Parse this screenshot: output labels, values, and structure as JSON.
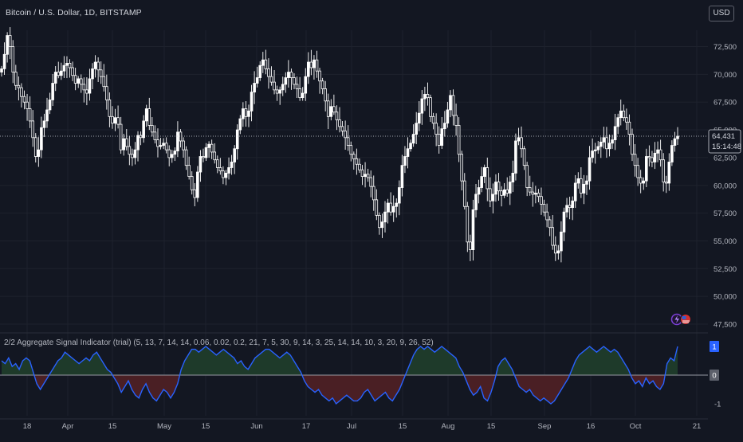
{
  "header": {
    "symbol_title": "Bitcoin / U.S. Dollar, 1D, BITSTAMP",
    "currency_button": "USD"
  },
  "price_pane": {
    "last_price_label": "64,431",
    "countdown_label": "15:14:48"
  },
  "indicator_pane": {
    "title": "2/2 Aggregate Signal Indicator (trial) (5, 13, 7, 14, 14, 0.06, 0.02, 0.2, 21, 7, 5, 30, 9, 14, 3, 25, 14, 14, 10, 3, 20, 9, 26, 52)",
    "current_value_label": "1"
  },
  "colors": {
    "background": "#131722",
    "grid": "#1e222d",
    "candle_up": "#ffffff",
    "candle_down": "#ffffff",
    "signal_line": "#2962ff",
    "positive_fill": "#1e3a2a",
    "negative_fill": "#4a1f24",
    "zero_line": "#9598a1",
    "price_label_bg": "#131722"
  },
  "chart_data": [
    {
      "type": "candlestick",
      "title": "Bitcoin / U.S. Dollar, 1D, BITSTAMP",
      "y_ticks": [
        "72,500",
        "70,000",
        "67,500",
        "65,000",
        "62,500",
        "60,000",
        "57,500",
        "55,000",
        "52,500",
        "50,000",
        "47,500"
      ],
      "x_ticks": [
        "18",
        "Apr",
        "15",
        "May",
        "15",
        "Jun",
        "17",
        "Jul",
        "15",
        "Aug",
        "15",
        "Sep",
        "16",
        "Oct",
        "21"
      ],
      "ylim": [
        47500,
        73000
      ],
      "last_price": 64431,
      "close_series": [
        70500,
        71800,
        73500,
        72500,
        70200,
        69000,
        68800,
        68000,
        67500,
        66900,
        65800,
        64300,
        62600,
        63200,
        65200,
        65800,
        66800,
        67700,
        69200,
        70200,
        69900,
        70300,
        70800,
        71000,
        70600,
        69900,
        69200,
        69600,
        69100,
        68600,
        68300,
        69600,
        70500,
        71100,
        70400,
        69800,
        68900,
        67700,
        66200,
        65600,
        66100,
        65500,
        63200,
        64200,
        63500,
        62800,
        62500,
        63200,
        64500,
        64300,
        65800,
        66900,
        65400,
        64800,
        64100,
        63500,
        63600,
        63800,
        63200,
        62500,
        62800,
        63100,
        64800,
        64000,
        63200,
        61800,
        60800,
        59600,
        58900,
        61200,
        62600,
        62500,
        63400,
        63700,
        63000,
        62300,
        61600,
        61300,
        60700,
        61100,
        61600,
        62100,
        63300,
        65000,
        66000,
        66900,
        66200,
        66700,
        68400,
        69200,
        69700,
        70800,
        71300,
        70500,
        69800,
        69300,
        68600,
        68300,
        68600,
        69100,
        69700,
        70200,
        69700,
        69100,
        68700,
        67900,
        68300,
        69800,
        71100,
        70600,
        71300,
        70300,
        69400,
        68700,
        67600,
        66200,
        67100,
        66600,
        65900,
        65300,
        64900,
        64300,
        63600,
        62800,
        62400,
        61900,
        61400,
        60800,
        61000,
        60700,
        59900,
        58700,
        57300,
        56200,
        56700,
        57600,
        58400,
        57600,
        58100,
        58400,
        59800,
        61800,
        62600,
        63300,
        63800,
        64600,
        65600,
        66500,
        67800,
        68200,
        67900,
        66200,
        65600,
        64600,
        63600,
        65100,
        65600,
        66800,
        68100,
        66300,
        65400,
        62800,
        60400,
        58100,
        54900,
        54200,
        57800,
        59200,
        59800,
        60800,
        61600,
        59700,
        58600,
        59200,
        60300,
        59500,
        59100,
        59600,
        59300,
        60300,
        61100,
        64000,
        64300,
        63300,
        61800,
        59800,
        59400,
        59200,
        59300,
        59000,
        58300,
        57600,
        56900,
        56200,
        54600,
        53900,
        54100,
        55800,
        57600,
        58200,
        58000,
        58600,
        60200,
        60600,
        59300,
        60100,
        60400,
        62500,
        63100,
        63200,
        63500,
        63900,
        64300,
        63300,
        63800,
        64100,
        65300,
        66100,
        66700,
        66100,
        65700,
        64600,
        62800,
        61800,
        60700,
        60200,
        60400,
        62600,
        62500,
        62100,
        62900,
        63200,
        62300,
        60300,
        60200,
        62100,
        63600,
        64200,
        64431
      ]
    },
    {
      "type": "area",
      "title": "2/2 Aggregate Signal Indicator (trial)",
      "y_ticks": [
        "1",
        "0",
        "-1"
      ],
      "ylim": [
        -1.15,
        1.1
      ],
      "values": [
        0.5,
        0.4,
        0.6,
        0.3,
        0.4,
        0.2,
        0.5,
        0.6,
        0.5,
        0.1,
        -0.3,
        -0.5,
        -0.3,
        -0.1,
        0.1,
        0.3,
        0.5,
        0.6,
        0.8,
        0.7,
        0.6,
        0.5,
        0.4,
        0.5,
        0.6,
        0.5,
        0.7,
        0.8,
        0.6,
        0.4,
        0.2,
        0.1,
        -0.1,
        -0.3,
        -0.6,
        -0.4,
        -0.2,
        -0.5,
        -0.7,
        -0.8,
        -0.5,
        -0.3,
        -0.6,
        -0.8,
        -0.9,
        -0.7,
        -0.5,
        -0.6,
        -0.8,
        -0.6,
        -0.3,
        0.2,
        0.5,
        0.7,
        0.9,
        0.9,
        0.8,
        0.9,
        1.0,
        0.9,
        0.8,
        0.7,
        0.8,
        0.9,
        0.8,
        0.7,
        0.6,
        0.4,
        0.5,
        0.3,
        0.2,
        0.4,
        0.6,
        0.7,
        0.8,
        0.9,
        0.9,
        0.8,
        0.7,
        0.6,
        0.7,
        0.8,
        0.7,
        0.5,
        0.3,
        0.1,
        -0.2,
        -0.4,
        -0.5,
        -0.6,
        -0.5,
        -0.7,
        -0.8,
        -0.9,
        -0.8,
        -1.0,
        -0.9,
        -0.8,
        -0.7,
        -0.8,
        -0.9,
        -0.9,
        -0.8,
        -0.6,
        -0.5,
        -0.7,
        -0.9,
        -0.8,
        -0.7,
        -0.6,
        -0.8,
        -0.9,
        -0.7,
        -0.5,
        -0.2,
        0.1,
        0.4,
        0.7,
        0.9,
        1.0,
        0.9,
        1.0,
        0.9,
        0.8,
        0.9,
        1.0,
        0.9,
        0.8,
        0.7,
        0.6,
        0.3,
        0.1,
        -0.2,
        -0.5,
        -0.7,
        -0.6,
        -0.4,
        -0.8,
        -0.9,
        -0.6,
        -0.2,
        0.3,
        0.5,
        0.6,
        0.4,
        0.2,
        -0.1,
        -0.4,
        -0.5,
        -0.6,
        -0.5,
        -0.7,
        -0.8,
        -0.9,
        -0.8,
        -0.9,
        -1.0,
        -0.9,
        -0.7,
        -0.5,
        -0.3,
        -0.1,
        0.2,
        0.5,
        0.7,
        0.8,
        0.9,
        1.0,
        0.9,
        0.8,
        0.9,
        1.0,
        0.9,
        0.8,
        0.9,
        0.8,
        0.6,
        0.4,
        0.2,
        -0.1,
        -0.3,
        -0.2,
        -0.4,
        -0.1,
        -0.3,
        -0.2,
        -0.4,
        -0.5,
        -0.3,
        0.4,
        0.6,
        0.5,
        1.0
      ]
    }
  ]
}
